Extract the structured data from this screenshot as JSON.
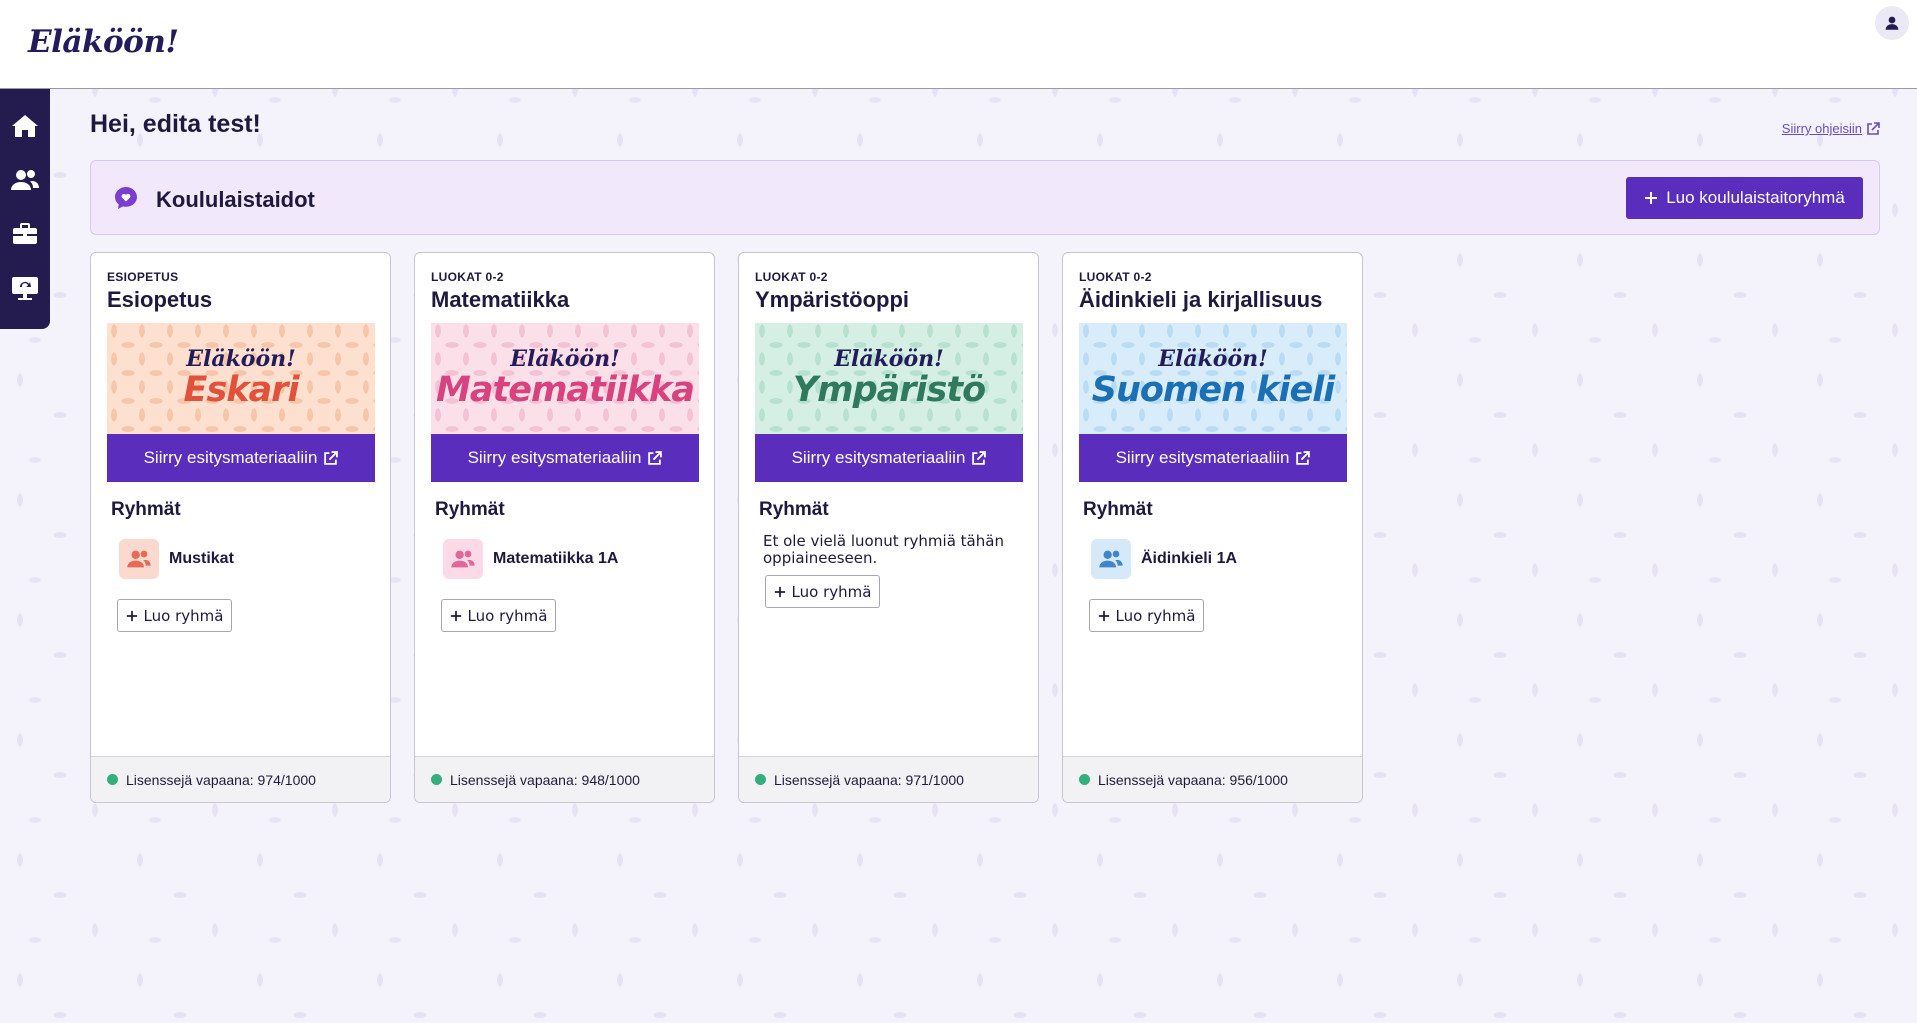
{
  "app": {
    "logo": "Eläköön!"
  },
  "header": {
    "user_icon": "user-icon"
  },
  "sidebar": {
    "items": [
      {
        "name": "home",
        "icon": "home-icon"
      },
      {
        "name": "groups",
        "icon": "users-icon"
      },
      {
        "name": "materials",
        "icon": "briefcase-icon"
      },
      {
        "name": "presentation",
        "icon": "presentation-icon"
      }
    ]
  },
  "main": {
    "greeting": "Hei, edita test!",
    "help_link": "Siirry ohjeisiin"
  },
  "banner": {
    "title": "Koululaistaidot",
    "button_label": "Luo koululaistaitoryhmä",
    "icon": "chat-heart-icon"
  },
  "cards": [
    {
      "grade": "ESIOPETUS",
      "title": "Esiopetus",
      "image_brand": "Eläköön!",
      "image_subject": "Eskari",
      "material_button": "Siirry esitysmateriaaliin",
      "groups_heading": "Ryhmät",
      "group_name": "Mustikat",
      "create_group": "Luo ryhmä",
      "license": "Lisenssejä vapaana: 974/1000",
      "colors": {
        "bg": "#fde0d0",
        "accent": "#e2513a",
        "leaf": "#f7c5aa",
        "icon_bg": "#fbd9cf",
        "icon": "#e66a55"
      }
    },
    {
      "grade": "LUOKAT 0-2",
      "title": "Matematiikka",
      "image_brand": "Eläköön!",
      "image_subject": "Matematiikka",
      "material_button": "Siirry esitysmateriaaliin",
      "groups_heading": "Ryhmät",
      "group_name": "Matematiikka 1A",
      "create_group": "Luo ryhmä",
      "license": "Lisenssejä vapaana: 948/1000",
      "colors": {
        "bg": "#fbe0ea",
        "accent": "#d8427f",
        "leaf": "#f5c1d5",
        "icon_bg": "#fbd9e6",
        "icon": "#e0679a"
      }
    },
    {
      "grade": "LUOKAT 0-2",
      "title": "Ympäristöoppi",
      "image_brand": "Eläköön!",
      "image_subject": "Ympäristö",
      "material_button": "Siirry esitysmateriaaliin",
      "groups_heading": "Ryhmät",
      "empty_text": "Et ole vielä luonut ryhmiä tähän oppiaineeseen.",
      "create_group": "Luo ryhmä",
      "license": "Lisenssejä vapaana: 971/1000",
      "colors": {
        "bg": "#d6efe5",
        "accent": "#2f7a5d",
        "leaf": "#b7e1cf",
        "icon_bg": "#d6efe5",
        "icon": "#2f7a5d"
      }
    },
    {
      "grade": "LUOKAT 0-2",
      "title": "Äidinkieli ja kirjallisuus",
      "image_brand": "Eläköön!",
      "image_subject": "Suomen kieli",
      "material_button": "Siirry esitysmateriaaliin",
      "groups_heading": "Ryhmät",
      "group_name": "Äidinkieli 1A",
      "create_group": "Luo ryhmä",
      "license": "Lisenssejä vapaana: 956/1000",
      "colors": {
        "bg": "#d8ecfa",
        "accent": "#1b6fb5",
        "leaf": "#b9dcf4",
        "icon_bg": "#d6e9f8",
        "icon": "#3f86c8"
      }
    }
  ],
  "theme": {
    "primary": "#5b2dbd",
    "nav": "#241c4f",
    "license_dot": "#33b07a"
  }
}
